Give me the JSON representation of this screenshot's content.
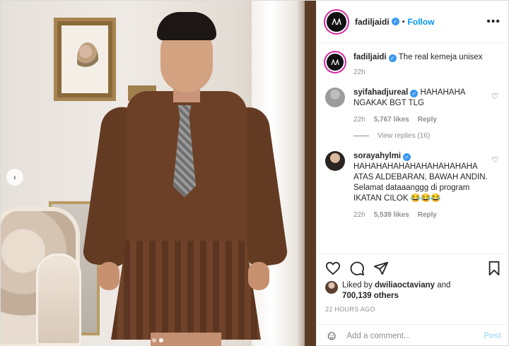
{
  "header": {
    "username": "fadiljaidi",
    "separator": "•",
    "follow_label": "Follow",
    "more_label": "•••"
  },
  "caption": {
    "username": "fadiljaidi",
    "text": "The real kemeja unisex",
    "time": "22h"
  },
  "comments": [
    {
      "username": "syifahadjureal",
      "text": "HAHAHAHA NGAKAK BGT TLG",
      "time": "22h",
      "likes": "5,767 likes",
      "reply_label": "Reply",
      "view_replies": "View replies (16)"
    },
    {
      "username": "sorayahylmi",
      "text": "HAHAHAHAHAHAHAHAHAHAHA ATAS ALDEBARAN, BAWAH ANDIN. Selamat dataaanggg di program IKATAN CILOK 😂😂😂",
      "time": "22h",
      "likes": "5,539 likes",
      "reply_label": "Reply"
    }
  ],
  "likes": {
    "prefix": "Liked by ",
    "user": "dwiliaoctaviany",
    "mid": " and ",
    "count": "700,139 others"
  },
  "timestamp": "22 HOURS AGO",
  "add_comment": {
    "placeholder": "Add a comment...",
    "post_label": "Post"
  },
  "icons": {
    "emoji": "☺",
    "heart_small": "♡",
    "verified": "✓",
    "prev": "‹"
  },
  "colors": {
    "link": "#0095f6",
    "verified": "#3897f0",
    "muted": "#8e8e8e",
    "post_disabled": "#b2dffc"
  }
}
